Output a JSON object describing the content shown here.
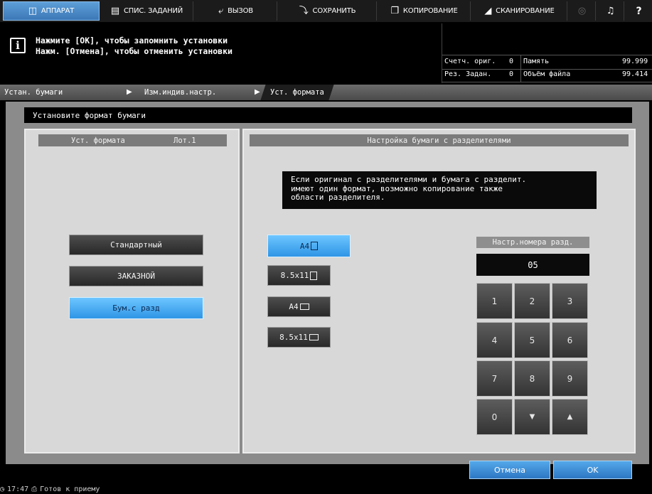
{
  "menu": {
    "device": "АППАРАТ",
    "job_list": "СПИС. ЗАДАНИЙ",
    "recall": "ВЫЗОВ",
    "save": "СОХРАНИТЬ",
    "copy": "КОПИРОВАНИЕ",
    "scan": "СКАНИРОВАНИЕ",
    "help": "?"
  },
  "message": {
    "line1": "Нажмите [OK], чтобы запомнить установки",
    "line2": "Нажм. [Отмена], чтобы отменить установки"
  },
  "status": {
    "originals_label": "Счетч. ориг.",
    "originals_value": "0",
    "memory_label": "Память",
    "memory_value": "99.999",
    "reserved_label": "Рез. Задан.",
    "reserved_value": "0",
    "filesize_label": "Объём файла",
    "filesize_value": "99.414"
  },
  "breadcrumb": [
    "Устан. бумаги",
    "Изм.индив.настр.",
    "Уст. формата"
  ],
  "window_title": "Установите формат бумаги",
  "left_panel": {
    "title": "Уст. формата",
    "tray": "Лот.1",
    "options": [
      "Стандартный",
      "ЗАКАЗНОЙ",
      "Бум.с разд"
    ],
    "selected_index": 2
  },
  "right_panel": {
    "title": "Настройка бумаги с разделителями",
    "notice": [
      "Если оригинал с разделителями и бумага с разделит.",
      "имеют один формат, возможно копирование также",
      "области разделителя."
    ],
    "sizes": [
      "A4",
      "8.5x11",
      "A4",
      "8.5x11"
    ],
    "selected_size_index": 0,
    "tab_number_label": "Настр.номера разд.",
    "tab_number_value": "05",
    "keypad": [
      "1",
      "2",
      "3",
      "4",
      "5",
      "6",
      "7",
      "8",
      "9",
      "0",
      "▼",
      "▲"
    ]
  },
  "footer": {
    "cancel": "Отмена",
    "ok": "OK"
  },
  "statusbar": {
    "time": "17:47",
    "state": "Готов к приему"
  },
  "colors": {
    "selected": "#3aa7f0",
    "footer_button": "#3f8fd6",
    "panel": "#d8d8d8"
  }
}
